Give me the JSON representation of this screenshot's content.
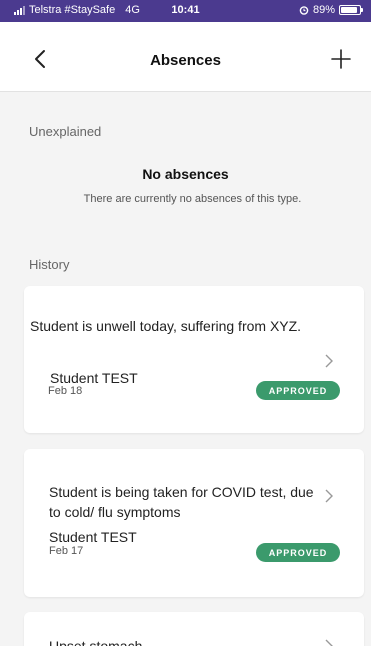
{
  "status_bar": {
    "carrier": "Telstra #StaySafe",
    "network": "4G",
    "time": "10:41",
    "battery": "89%",
    "battery_fraction": 0.89
  },
  "nav": {
    "back_icon": "chevron-left-icon",
    "title": "Absences",
    "add_icon": "plus-icon"
  },
  "unexplained": {
    "label": "Unexplained",
    "empty_title": "No absences",
    "empty_desc": "There are currently no absences of this type."
  },
  "history": {
    "label": "History",
    "items": [
      {
        "reason": "Student is unwell today, suffering from XYZ.",
        "student": "Student TEST",
        "date": "Feb 18",
        "status": "APPROVED"
      },
      {
        "reason": "Student is being taken for COVID test, due to cold/ flu symptoms",
        "student": "Student TEST",
        "date": "Feb 17",
        "status": "APPROVED"
      },
      {
        "reason": "Upset stomach"
      }
    ]
  },
  "colors": {
    "status_bar": "#4b3a8f",
    "badge_approved": "#3b9a6c",
    "background": "#f4f4f4"
  }
}
